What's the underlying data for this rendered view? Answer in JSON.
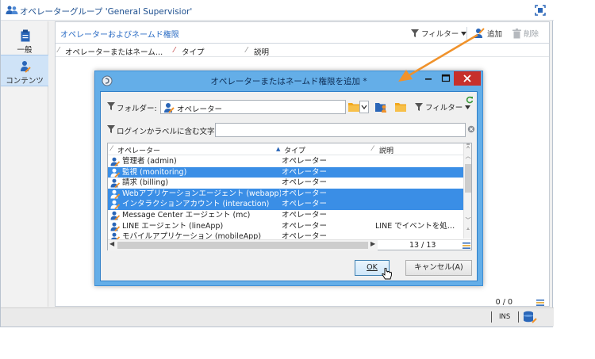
{
  "window": {
    "title": "オペレーターグループ 'General Supervisior'"
  },
  "nav": {
    "items": [
      {
        "label": "一般"
      },
      {
        "label": "コンテンツ"
      }
    ]
  },
  "content": {
    "section_title": "オペレーターおよびネームド権限",
    "toolbar": {
      "filter_label": "フィルター",
      "add_label": "追加",
      "delete_label": "削除"
    },
    "columns": [
      "オペレーターまたはネーム…",
      "タイプ",
      "説明"
    ],
    "count": "0 / 0"
  },
  "statusbar": {
    "ins": "INS"
  },
  "dialog": {
    "title": "オペレーターまたはネームド権限を追加 *",
    "folder_label": "フォルダー:",
    "folder_value": "オペレーター",
    "filter_label": "フィルター",
    "search_label": "ログインかラベルに含む文字:",
    "search_value": "",
    "columns": [
      "オペレーター",
      "タイプ",
      "説明"
    ],
    "rows": [
      {
        "name": "管理者 (admin)",
        "type": "オペレーター",
        "desc": "",
        "selected": false
      },
      {
        "name": "監視 (monitoring)",
        "type": "オペレーター",
        "desc": "",
        "selected": true
      },
      {
        "name": "請求 (billing)",
        "type": "オペレーター",
        "desc": "",
        "selected": false
      },
      {
        "name": "Webアプリケーションエージェント (webapp)",
        "type": "オペレーター",
        "desc": "",
        "selected": true
      },
      {
        "name": "インタラクションアカウント (interaction)",
        "type": "オペレーター",
        "desc": "",
        "selected": true
      },
      {
        "name": "Message Center エージェント (mc)",
        "type": "オペレーター",
        "desc": "",
        "selected": false
      },
      {
        "name": "LINE エージェント (lineApp)",
        "type": "オペレーター",
        "desc": "LINE でイベントを処…",
        "selected": false
      },
      {
        "name": "モバイルアプリケーション (mobileApp)",
        "type": "オペレーター",
        "desc": "",
        "selected": false
      }
    ],
    "pager": "13 / 13",
    "ok_label": "OK",
    "cancel_label": "キャンセル(A)"
  },
  "colors": {
    "accent": "#2b6cc4",
    "selection": "#3a8ee6",
    "dialog_frame": "#64aee8",
    "close_button": "#c7302b",
    "arrow": "#f0922b"
  }
}
